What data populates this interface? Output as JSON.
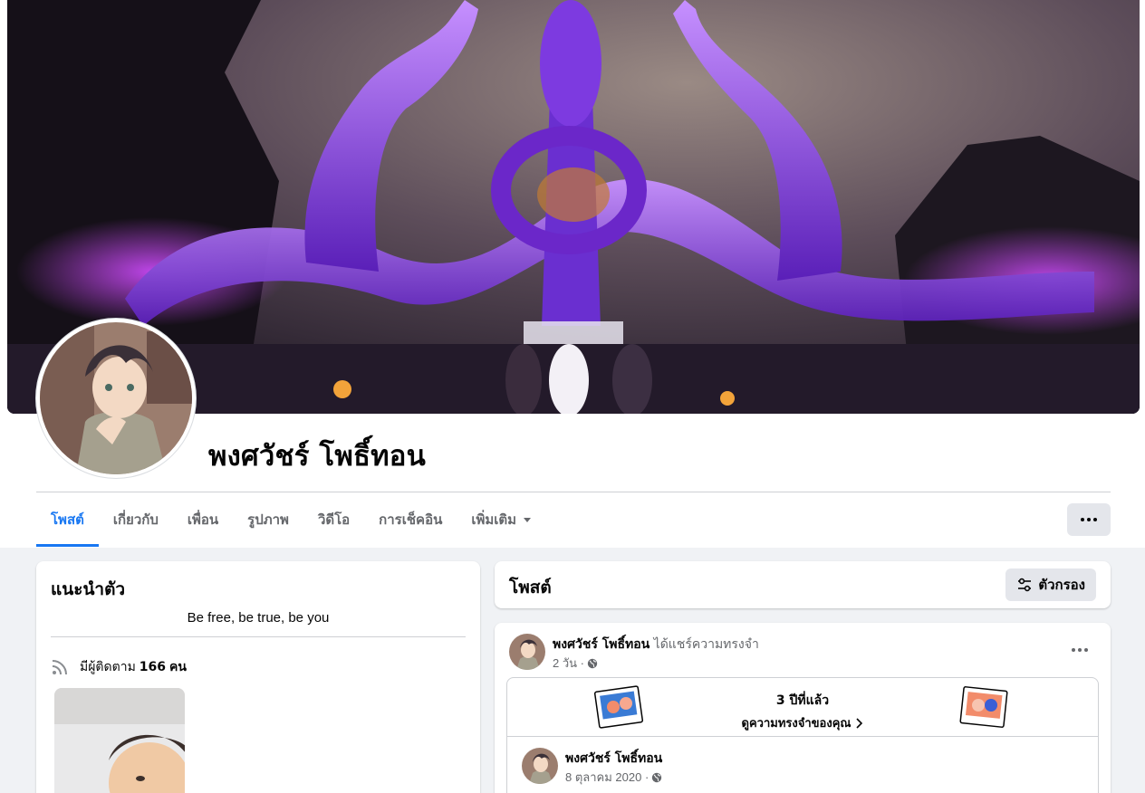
{
  "profile": {
    "name": "พงศวัชร์ โพธิ์ทอน"
  },
  "tabs": [
    {
      "label": "โพสต์"
    },
    {
      "label": "เกี่ยวกับ"
    },
    {
      "label": "เพื่อน"
    },
    {
      "label": "รูปภาพ"
    },
    {
      "label": "วิดีโอ"
    },
    {
      "label": "การเช็คอิน"
    },
    {
      "label": "เพิ่มเติม"
    }
  ],
  "intro": {
    "title": "แนะนำตัว",
    "bio": "Be free, be true, be you",
    "followers_prefix": "มีผู้ติดตาม",
    "followers_count": "166",
    "followers_suffix": "คน"
  },
  "posts_header": {
    "title": "โพสต์",
    "filter_label": "ตัวกรอง"
  },
  "post": {
    "author": "พงศวัชร์ โพธิ์ทอน",
    "action": "ได้แชร์ความทรงจำ",
    "time": "2 วัน ·",
    "memory": {
      "years": "3 ปีที่แล้ว",
      "link": "ดูความทรงจำของคุณ"
    },
    "inner_author": "พงศวัชร์ โพธิ์ทอน",
    "inner_time": "8 ตุลาคม 2020 ·"
  },
  "colors": {
    "accent": "#1877f2",
    "background": "#f0f2f5",
    "secondary_text": "#65676b"
  }
}
